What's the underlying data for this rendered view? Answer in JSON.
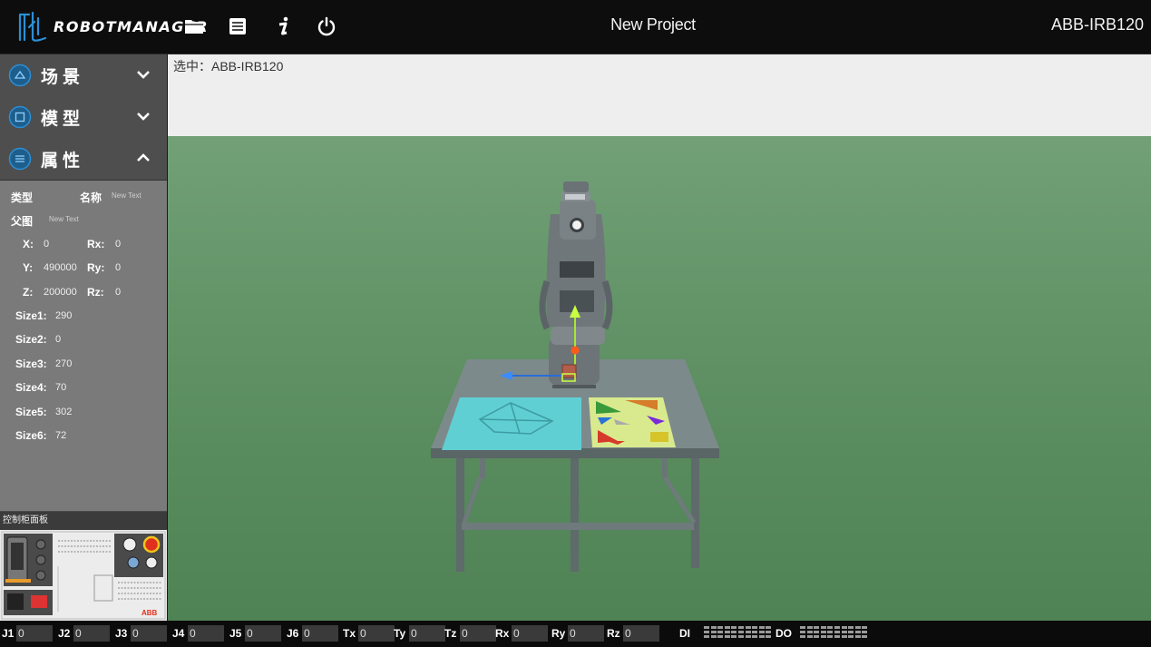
{
  "header": {
    "brand": "ROBOTMANAGER",
    "project_title": "New Project",
    "robot_name": "ABB-IRB120",
    "icons": [
      "folder-icon",
      "list-icon",
      "info-icon",
      "power-icon"
    ]
  },
  "sidebar": {
    "sections": [
      {
        "label": "场景",
        "icon": "scene-icon",
        "state": "collapsed"
      },
      {
        "label": "模型",
        "icon": "model-icon",
        "state": "collapsed"
      },
      {
        "label": "属性",
        "icon": "property-icon",
        "state": "expanded"
      }
    ],
    "properties": {
      "type_label": "类型",
      "name_label": "名称",
      "name_value": "New Text",
      "parent_label": "父图",
      "parent_value": "New Text",
      "x_label": "X:",
      "x_value": "0",
      "y_label": "Y:",
      "y_value": "490000",
      "z_label": "Z:",
      "z_value": "200000",
      "rx_label": "Rx:",
      "rx_value": "0",
      "ry_label": "Ry:",
      "ry_value": "0",
      "rz_label": "Rz:",
      "rz_value": "0",
      "sizes": [
        {
          "label": "Size1:",
          "value": "290"
        },
        {
          "label": "Size2:",
          "value": "0"
        },
        {
          "label": "Size3:",
          "value": "270"
        },
        {
          "label": "Size4:",
          "value": "70"
        },
        {
          "label": "Size5:",
          "value": "302"
        },
        {
          "label": "Size6:",
          "value": "72"
        }
      ]
    },
    "control_panel_label": "控制柜面板",
    "control_panel_brand": "ABB"
  },
  "viewport": {
    "selected_text": "选中：ABB-IRB120"
  },
  "bottombar": {
    "fields": [
      {
        "label": "J1",
        "value": "0"
      },
      {
        "label": "J2",
        "value": "0"
      },
      {
        "label": "J3",
        "value": "0"
      },
      {
        "label": "J4",
        "value": "0"
      },
      {
        "label": "J5",
        "value": "0"
      },
      {
        "label": "J6",
        "value": "0"
      },
      {
        "label": "Tx",
        "value": "0"
      },
      {
        "label": "Ty",
        "value": "0"
      },
      {
        "label": "Tz",
        "value": "0"
      },
      {
        "label": "Rx",
        "value": "0"
      },
      {
        "label": "Ry",
        "value": "0"
      },
      {
        "label": "Rz",
        "value": "0"
      }
    ],
    "di_label": "DI",
    "do_label": "DO"
  },
  "colors": {
    "accent_blue": "#2a8fd6",
    "ground_green": "#5e9463",
    "table_cyan": "#5fcfd4",
    "puzzle_board": "#d9ea8e"
  }
}
